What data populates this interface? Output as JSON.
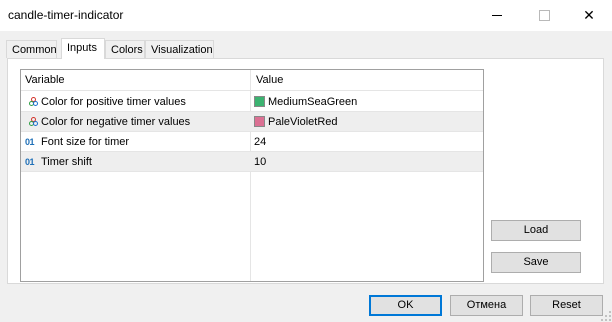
{
  "window": {
    "title": "candle-timer-indicator"
  },
  "tabs": [
    {
      "label": "Common"
    },
    {
      "label": "Inputs"
    },
    {
      "label": "Colors"
    },
    {
      "label": "Visualization"
    }
  ],
  "grid": {
    "headers": {
      "variable": "Variable",
      "value": "Value"
    },
    "rows": [
      {
        "icon": "color-palette-icon",
        "variable": "Color for positive timer values",
        "value": "MediumSeaGreen",
        "swatch": "#3cb371"
      },
      {
        "icon": "color-palette-icon",
        "variable": "Color for negative timer values",
        "value": "PaleVioletRed",
        "swatch": "#db7093"
      },
      {
        "icon": "integer-01-icon",
        "icon_text": "01",
        "variable": "Font size for timer",
        "value": "24"
      },
      {
        "icon": "integer-01-icon",
        "icon_text": "01",
        "variable": "Timer shift",
        "value": "10"
      }
    ]
  },
  "side_buttons": {
    "load": "Load",
    "save": "Save"
  },
  "footer_buttons": {
    "ok": "OK",
    "cancel": "Отмена",
    "reset": "Reset"
  }
}
